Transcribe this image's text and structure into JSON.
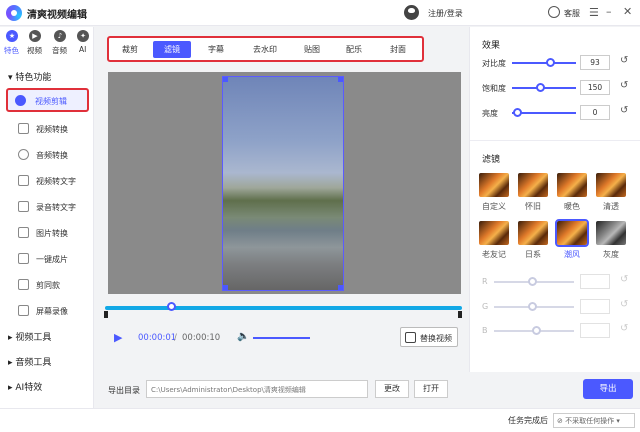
{
  "title_bar": {
    "app_name": "清爽视频编辑",
    "login": "注册/登录",
    "support": "客服",
    "logo_icon": "app-logo-icon",
    "menu_icon": "hamburger-icon",
    "minimize_icon": "minimize-icon",
    "close_icon": "close-icon"
  },
  "sidebar": {
    "modes": [
      {
        "label": "特色",
        "icon": "star-icon"
      },
      {
        "label": "视频",
        "icon": "video-icon"
      },
      {
        "label": "音频",
        "icon": "music-icon"
      },
      {
        "label": "AI",
        "icon": "ai-icon"
      }
    ],
    "section_feature": "特色功能",
    "items": [
      {
        "label": "视频剪辑",
        "icon": "scissors-icon"
      },
      {
        "label": "视频转换",
        "icon": "video-convert-icon"
      },
      {
        "label": "音频转换",
        "icon": "mic-icon"
      },
      {
        "label": "视频转文字",
        "icon": "video-text-icon"
      },
      {
        "label": "录音转文字",
        "icon": "record-text-icon"
      },
      {
        "label": "图片转换",
        "icon": "image-icon"
      },
      {
        "label": "一键成片",
        "icon": "oneclick-icon"
      },
      {
        "label": "剪同款",
        "icon": "template-icon"
      },
      {
        "label": "屏幕录像",
        "icon": "screen-record-icon"
      }
    ],
    "section_video_tools": "视频工具",
    "section_audio_tools": "音频工具",
    "section_ai": "AI特效"
  },
  "tabs": [
    "裁剪",
    "滤镜",
    "字幕",
    "去水印",
    "贴图",
    "配乐",
    "封面"
  ],
  "active_tab": "滤镜",
  "player": {
    "current_time": "00:00:01",
    "separator": "/",
    "total_time": "00:00:10",
    "progress": 0.18,
    "volume": 0.6,
    "replace_label": "替换视频"
  },
  "export": {
    "label": "导出目录",
    "path": "C:\\Users\\Administrator\\Desktop\\清爽视频编辑",
    "change_label": "更改",
    "open_label": "打开",
    "export_label": "导出"
  },
  "effects": {
    "title": "效果",
    "rows": [
      {
        "label": "对比度",
        "value": "93",
        "level": 0.62
      },
      {
        "label": "饱和度",
        "value": "150",
        "level": 0.5
      },
      {
        "label": "亮度",
        "value": "0",
        "level": 0.12
      }
    ]
  },
  "filters": {
    "title": "滤镜",
    "items": [
      "自定义",
      "怀旧",
      "暖色",
      "清透",
      "老友记",
      "日系",
      "潮风",
      "灰度"
    ],
    "selected": "潮风",
    "rgb": [
      {
        "label": "R",
        "value": ""
      },
      {
        "label": "G",
        "value": ""
      },
      {
        "label": "B",
        "value": ""
      }
    ]
  },
  "status_bar": {
    "after_label": "任务完成后",
    "after_value": "不采取任何操作"
  },
  "colors": {
    "accent": "#4b59ff",
    "highlight_border": "#e0303a",
    "timeline": "#12a8e6"
  }
}
